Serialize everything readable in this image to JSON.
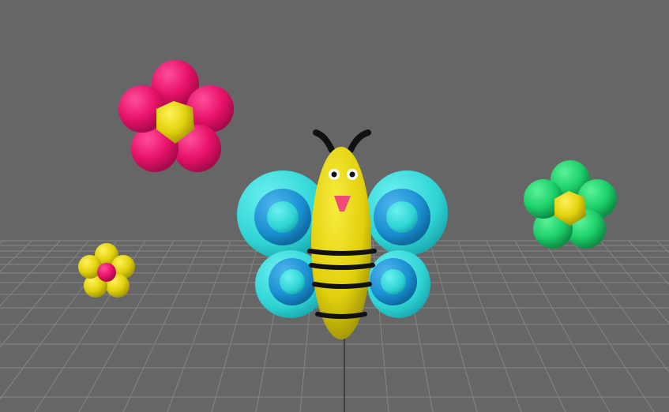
{
  "viewport": {
    "background": "#666666",
    "grid_color": "#7a7a7a",
    "grid_line_color": "#858585"
  },
  "objects": {
    "pink_flower": {
      "petal_color": "#e8126a",
      "center_color": "#e0cc0f"
    },
    "small_flower": {
      "petal_color": "#e6d40e",
      "center_color": "#e8126a"
    },
    "green_flower": {
      "petal_color": "#1ed16a",
      "center_color": "#e0cc0f"
    },
    "butterfly": {
      "body_color": "#e2d20e",
      "stripe_color": "#111111",
      "wing_outer_color": "#2fd4d4",
      "wing_ring_color": "#1a8fd0",
      "wing_inner_color": "#39d6d6",
      "nose_color": "#f04a7a",
      "antenna_color": "#111111"
    }
  }
}
